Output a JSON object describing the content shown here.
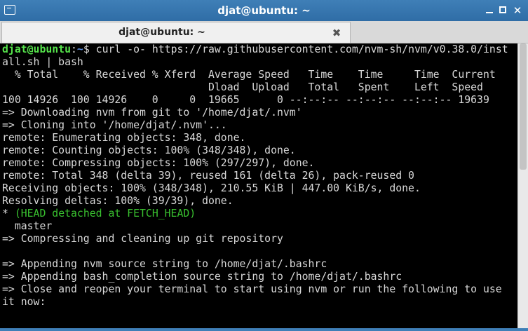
{
  "window": {
    "title": "djat@ubuntu: ~",
    "icon": "terminal-icon",
    "controls": [
      "minimize-icon",
      "maximize-icon",
      "close-icon"
    ]
  },
  "tab": {
    "label": "djat@ubuntu: ~",
    "close_glyph": "✖"
  },
  "terminal": {
    "prompt_user": "djat@ubuntu",
    "prompt_sep": ":",
    "prompt_path": "~",
    "prompt_symbol": "$ ",
    "command_part1": "curl -o- https://raw.githubusercontent.com/nvm-sh/nvm/v0.38.0/inst",
    "command_part2": "all.sh | bash",
    "lines": [
      "  % Total    % Received % Xferd  Average Speed   Time    Time     Time  Current",
      "                                 Dload  Upload   Total   Spent    Left  Speed",
      "100 14926  100 14926    0     0  19665      0 --:--:-- --:--:-- --:--:-- 19639",
      "=> Downloading nvm from git to '/home/djat/.nvm'",
      "=> Cloning into '/home/djat/.nvm'...",
      "remote: Enumerating objects: 348, done.",
      "remote: Counting objects: 100% (348/348), done.",
      "remote: Compressing objects: 100% (297/297), done.",
      "remote: Total 348 (delta 39), reused 161 (delta 26), pack-reused 0",
      "Receiving objects: 100% (348/348), 210.55 KiB | 447.00 KiB/s, done.",
      "Resolving deltas: 100% (39/39), done."
    ],
    "head_star": "*",
    "head_detached": " (HEAD detached at FETCH_HEAD)",
    "lines2": [
      "  master",
      "=> Compressing and cleaning up git repository",
      "",
      "=> Appending nvm source string to /home/djat/.bashrc",
      "=> Appending bash_completion source string to /home/djat/.bashrc",
      "=> Close and reopen your terminal to start using nvm or run the following to use",
      "it now:"
    ]
  },
  "colors": {
    "titlebar": "#3f7fb7",
    "prompt_user": "#55e34b",
    "prompt_path": "#5c8ee0",
    "head_text": "#39c12f",
    "terminal_bg": "#000000",
    "terminal_fg": "#d8d8d8"
  }
}
